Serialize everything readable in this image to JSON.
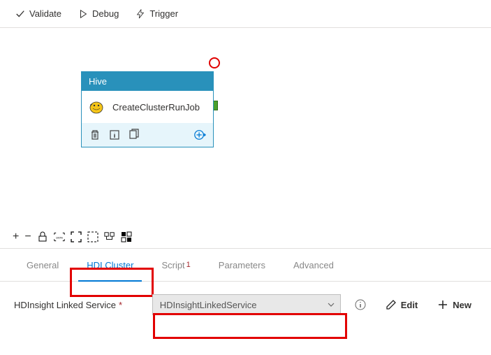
{
  "toolbar": {
    "validate": "Validate",
    "debug": "Debug",
    "trigger": "Trigger"
  },
  "activity": {
    "type": "Hive",
    "name": "CreateClusterRunJob"
  },
  "tabs": {
    "general": "General",
    "hdi_cluster": "HDI Cluster",
    "script": "Script",
    "script_badge": "1",
    "parameters": "Parameters",
    "advanced": "Advanced"
  },
  "form": {
    "linked_service_label": "HDInsight Linked Service",
    "linked_service_value": "HDInsightLinkedService",
    "edit": "Edit",
    "new": "New"
  }
}
